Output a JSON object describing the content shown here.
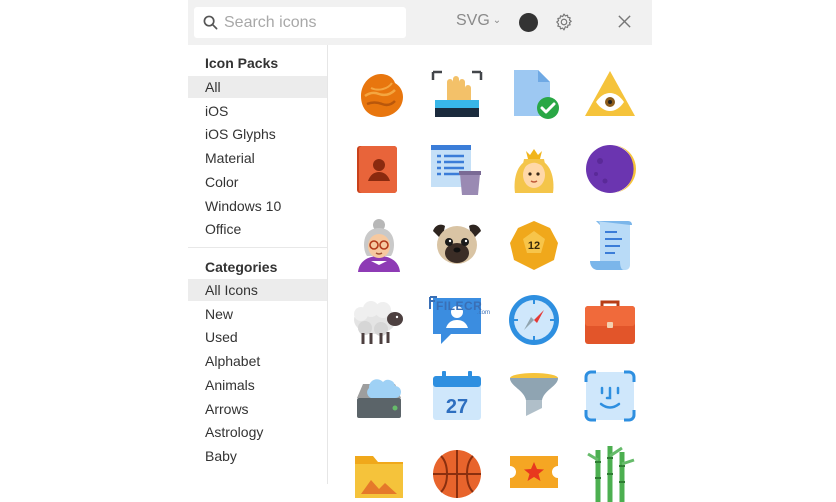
{
  "search": {
    "placeholder": "Search icons",
    "value": ""
  },
  "toolbar": {
    "format_label": "SVG",
    "color_value": "#333333",
    "settings_icon": "gear-icon",
    "close_icon": "close-icon"
  },
  "sidebar": {
    "icon_packs_title": "Icon Packs",
    "icon_packs": [
      "All",
      "iOS",
      "iOS Glyphs",
      "Material",
      "Color",
      "Windows 10",
      "Office"
    ],
    "icon_packs_selected": "All",
    "categories_title": "Categories",
    "categories": [
      "All Icons",
      "New",
      "Used",
      "Alphabet",
      "Animals",
      "Arrows",
      "Astrology",
      "Baby"
    ],
    "categories_selected": "All Icons"
  },
  "icons": [
    "hazelnut-icon",
    "hand-scanner-icon",
    "file-check-icon",
    "eye-of-providence-icon",
    "address-book-icon",
    "delete-list-icon",
    "princess-icon",
    "crescent-moon-icon",
    "grandmother-icon",
    "pug-icon",
    "d12-dice-icon",
    "scroll-icon",
    "sheep-icon",
    "contact-card-icon",
    "compass-icon",
    "briefcase-icon",
    "cloud-storage-icon",
    "calendar-27-icon",
    "funnel-icon",
    "face-id-icon",
    "image-folder-icon",
    "basketball-icon",
    "ticket-icon",
    "bamboo-icon"
  ],
  "calendar_day": "27",
  "dice_number": "12",
  "watermark": {
    "text": "FILECR",
    "domain": ".com"
  }
}
